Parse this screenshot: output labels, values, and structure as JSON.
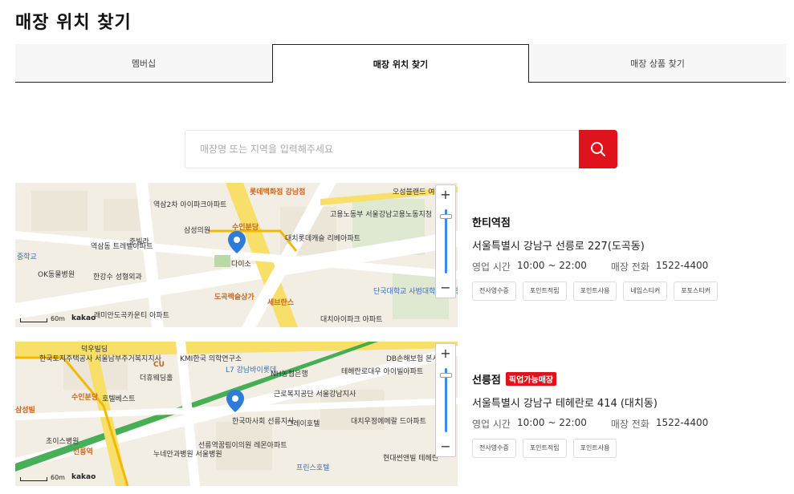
{
  "page": {
    "title": "매장 위치 찾기"
  },
  "tabs": [
    {
      "label": "멤버십"
    },
    {
      "label": "매장 위치 찾기",
      "active": true
    },
    {
      "label": "매장 상품 찾기"
    }
  ],
  "search": {
    "placeholder": "매장명 또는 지역을 입력해주세요",
    "value": "",
    "button_icon": "search-icon",
    "button_color": "#e0121b"
  },
  "map_controls": {
    "zoom_in": "+",
    "zoom_out": "−",
    "scale": "60m",
    "brand": "kakao"
  },
  "stores": [
    {
      "name": "한티역점",
      "badge": "",
      "address": "서울특별시 강남구 선릉로 227(도곡동)",
      "hours_label": "영업 시간",
      "hours": "10:00 ~ 22:00",
      "phone_label": "매장 전화",
      "phone": "1522-4400",
      "tags": [
        "전사영수증",
        "포인트적립",
        "포인트사용",
        "네임스티커",
        "포토스티커"
      ],
      "map_labels": [
        "롯데백화점 강남점",
        "역삼2차 아이파크아파트",
        "삼성의원",
        "다이소",
        "도곡렉슬상가",
        "대치롯데캐슬 리베아파트",
        "세브란스",
        "역삼동 트레벨아파트",
        "한강수 성형외과",
        "OK동물병원",
        "중학교",
        "래미안도곡카운티 아파트",
        "고용노동부 서울강남고용노동지청",
        "오성블랜드 여성전문",
        "단국대학교 사범대학부속고등학교",
        "대치아이파크 아파트",
        "준빌라",
        "수인분당"
      ]
    },
    {
      "name": "선릉점",
      "badge": "픽업가능매장",
      "address": "서울특별시 강남구 테헤란로 414 (대치동)",
      "hours_label": "영업 시간",
      "hours": "10:00 ~ 22:00",
      "phone_label": "매장 전화",
      "phone": "1522-4400",
      "tags": [
        "전사영수증",
        "포인트적립",
        "포인트사용"
      ],
      "map_labels": [
        "덕우빌딩",
        "한국토지주택공사 서울남부주거복지지사",
        "KMI한국 의학연구소",
        "L7 강남바이롯데",
        "NH농협은행",
        "테헤란로대우 아이빌아파트",
        "DB손해보험 본사",
        "더휴웨딩홀",
        "호텔베스트",
        "근로복지공단 서울강남지사",
        "한국마사회 선릉지사",
        "그레이호텔",
        "선릉역",
        "선릉역꿈림이의원 레몬아파트",
        "누네안과병원 서울병원",
        "프린스호텔",
        "대치우정에메랄 드아파트",
        "현대썬앤빌 테헤란",
        "초이스병원",
        "CU",
        "수인분당",
        "삼성빌"
      ]
    }
  ],
  "colors": {
    "accent": "#e0121b",
    "pin": "#2f7bd8",
    "line2": "#33a645",
    "line_bundang": "#f5b800"
  }
}
